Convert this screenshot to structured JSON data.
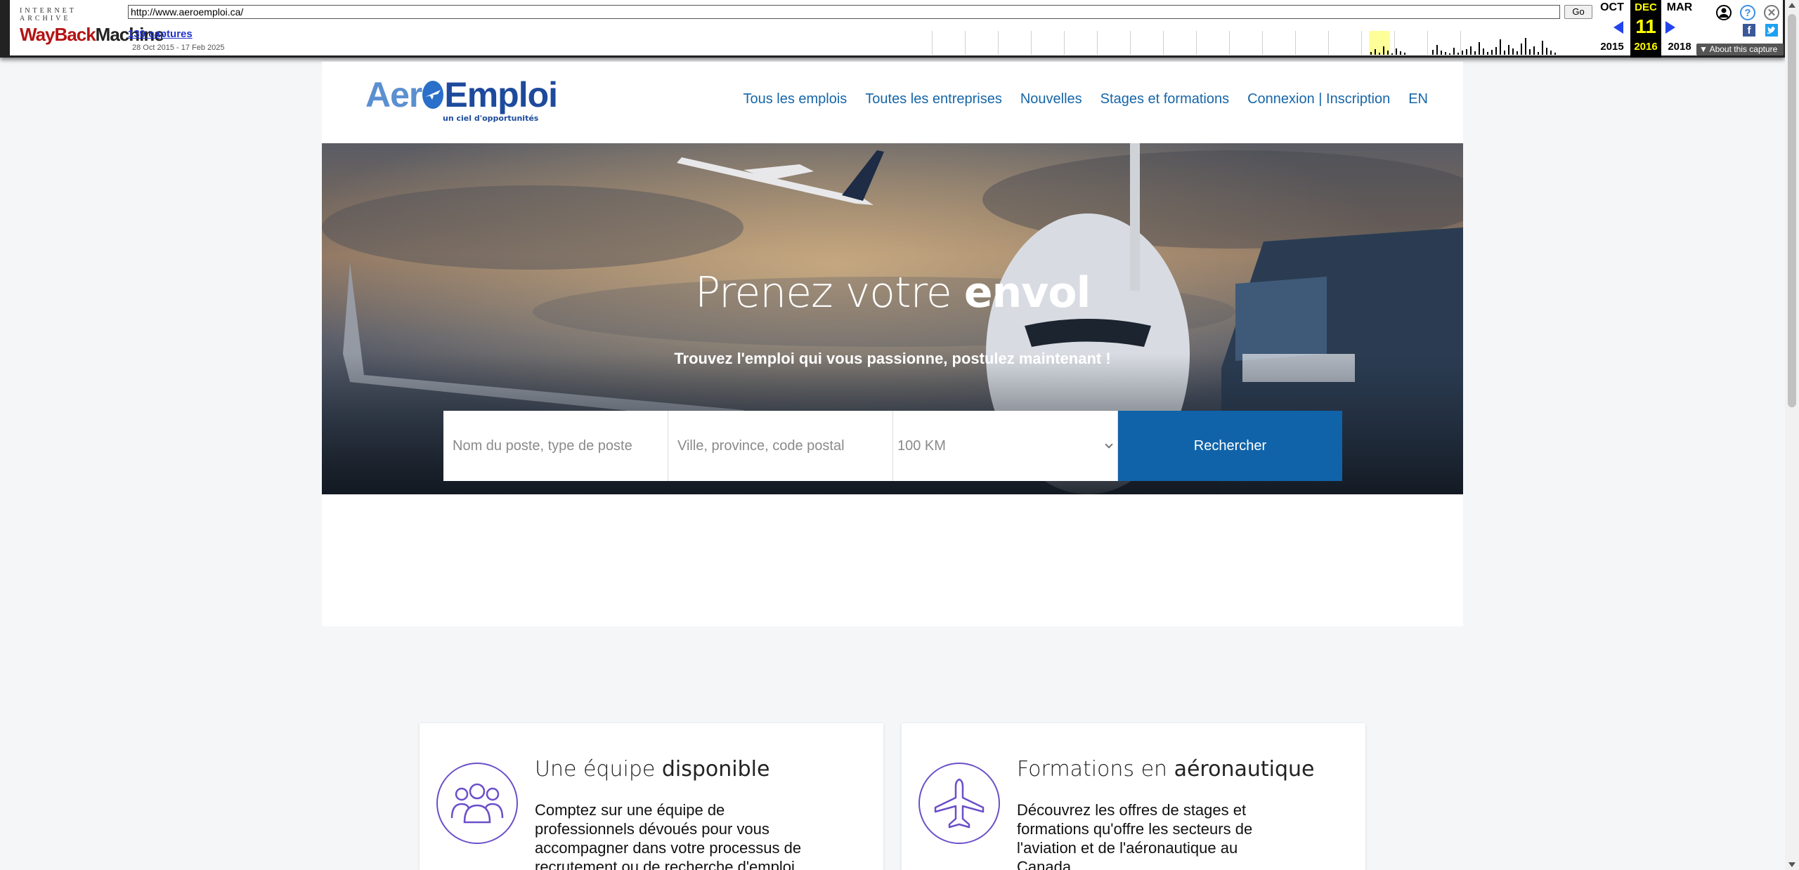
{
  "wayback": {
    "logo_top": "INTERNET ARCHIVE",
    "logo_wayback": "WayBack",
    "logo_machine": "Machine",
    "url": "http://www.aeroemploi.ca/",
    "go_label": "Go",
    "captures": "139 captures",
    "range": "28 Oct 2015 - 17 Feb 2025",
    "prev_month": "OCT",
    "prev_year": "2015",
    "cur_month": "DEC",
    "cur_day": "11",
    "cur_year": "2016",
    "next_month": "MAR",
    "next_year": "2018",
    "about": "About this capture"
  },
  "site": {
    "logo_aer": "Aer",
    "logo_emploi": "Emploi",
    "tagline": "un ciel d'opportunités",
    "nav": [
      "Tous les emplois",
      "Toutes les entreprises",
      "Nouvelles",
      "Stages et formations",
      "Connexion | Inscription",
      "EN"
    ]
  },
  "hero": {
    "title_light": "Prenez votre ",
    "title_bold": "envol",
    "subtitle": "Trouvez l'emploi qui vous passionne, postulez maintenant !",
    "job_placeholder": "Nom du poste, type de poste",
    "location_placeholder": "Ville, province, code postal",
    "distance": "100 KM",
    "search_button": "Rechercher"
  },
  "features": [
    {
      "title_light": "Une équipe ",
      "title_bold": "disponible",
      "text": "Comptez sur une équipe de professionnels dévoués pour vous accompagner dans votre processus de recrutement ou de recherche d'emploi.",
      "icon": "team-icon"
    },
    {
      "title_light": "Formations en ",
      "title_bold": "aéronautique",
      "text": "Découvrez les offres de stages et formations qu'offre les secteurs de l'aviation et de l'aéronautique au Canada.",
      "icon": "airplane-icon"
    }
  ],
  "colors": {
    "nav_link": "#1666a8",
    "search_button": "#1063a9",
    "feature_icon": "#6b4fc9"
  }
}
